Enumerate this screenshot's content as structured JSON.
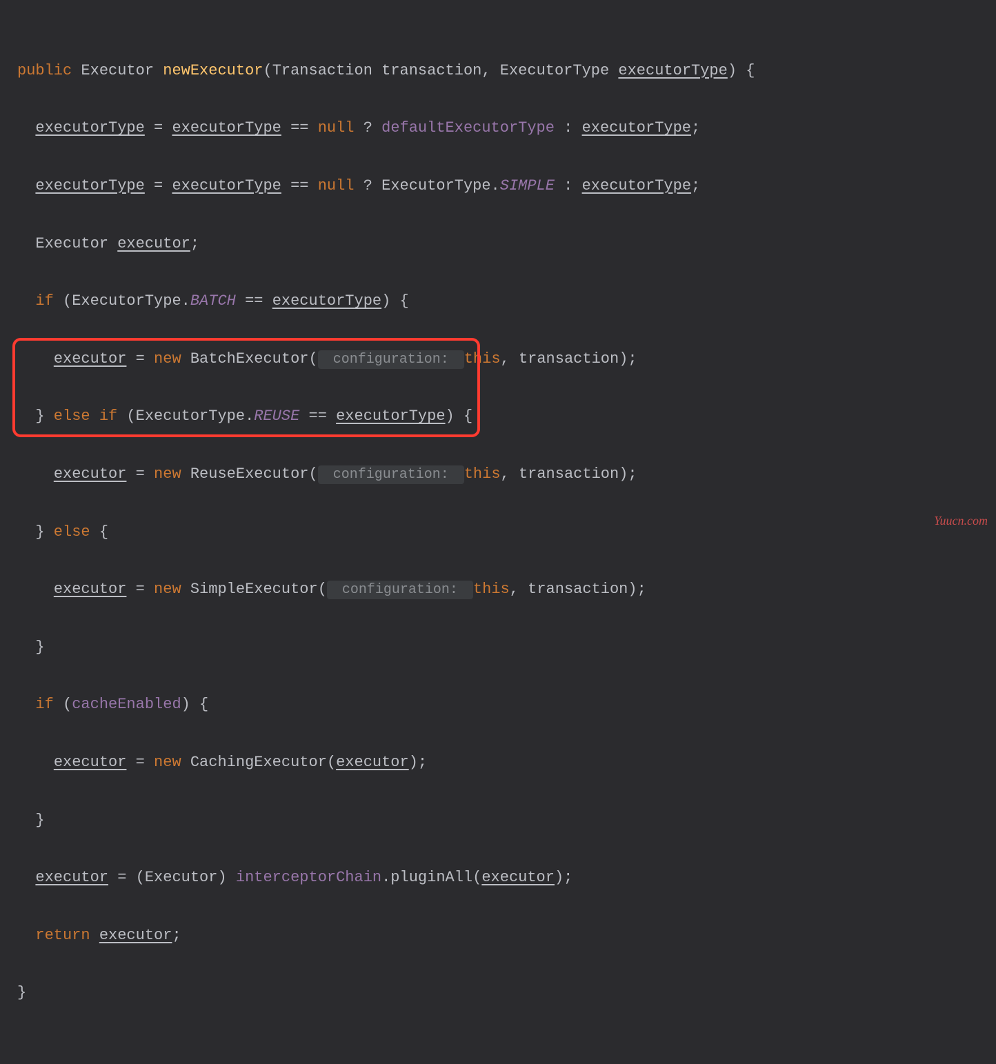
{
  "code": {
    "sig": {
      "public": "public",
      "retType": "Executor",
      "methodName": "newExecutor",
      "p1Type": "Transaction",
      "p1Name": "transaction",
      "p2Type": "ExecutorType",
      "p2Name": "executorType",
      "brace": "{"
    },
    "l2": {
      "lhs": "executorType",
      "eq": " = ",
      "rhs1": "executorType",
      "op": " == ",
      "nul": "null",
      "q": " ? ",
      "def": "defaultExecutorType",
      "colon": " : ",
      "rhs2": "executorType",
      "semi": ";"
    },
    "l3": {
      "lhs": "executorType",
      "eq": " = ",
      "rhs1": "executorType",
      "op": " == ",
      "nul": "null",
      "q": " ? ",
      "cls": "ExecutorType.",
      "simple": "SIMPLE",
      "colon": " : ",
      "rhs2": "executorType",
      "semi": ";"
    },
    "l4": {
      "type": "Executor",
      "var": "executor",
      "semi": ";"
    },
    "l5": {
      "if": "if",
      "open": " (",
      "cls": "ExecutorType.",
      "batch": "BATCH",
      "op": " == ",
      "var": "executorType",
      "close": ") {",
      "semi": ""
    },
    "l6": {
      "lhs": "executor",
      "eq": " = ",
      "new": "new",
      "ctor": " BatchExecutor(",
      "hint": " configuration: ",
      "this": "this",
      "comma": ", ",
      "arg": "transaction",
      "close": ");"
    },
    "l7": {
      "close": "}",
      "else": " else if",
      "open": " (",
      "cls": "ExecutorType.",
      "reuse": "REUSE",
      "op": " == ",
      "var": "executorType",
      "closeP": ") {"
    },
    "l8": {
      "lhs": "executor",
      "eq": " = ",
      "new": "new",
      "ctor": " ReuseExecutor(",
      "hint": " configuration: ",
      "this": "this",
      "comma": ", ",
      "arg": "transaction",
      "close": ");"
    },
    "l9": {
      "close": "}",
      "else": " else ",
      "brace": "{"
    },
    "l10": {
      "lhs": "executor",
      "eq": " = ",
      "new": "new",
      "ctor": " SimpleExecutor(",
      "hint": " configuration: ",
      "this": "this",
      "comma": ", ",
      "arg": "transaction",
      "close": ");"
    },
    "l11": {
      "close": "}"
    },
    "l12": {
      "if": "if",
      "open": " (",
      "field": "cacheEnabled",
      "close": ") {"
    },
    "l13": {
      "lhs": "executor",
      "eq": " = ",
      "new": "new",
      "ctor": " CachingExecutor(",
      "arg": "executor",
      "close": ");"
    },
    "l14": {
      "close": "}"
    },
    "l15": {
      "lhs": "executor",
      "eq": " = (",
      "cast": "Executor",
      "close1": ") ",
      "chain": "interceptorChain",
      "dot": ".pluginAll(",
      "arg": "executor",
      "close2": ");"
    },
    "l16": {
      "ret": "return",
      "sp": " ",
      "var": "executor",
      "semi": ";"
    },
    "l17": {
      "close": "}"
    }
  },
  "watermark": "Yuucn.com"
}
